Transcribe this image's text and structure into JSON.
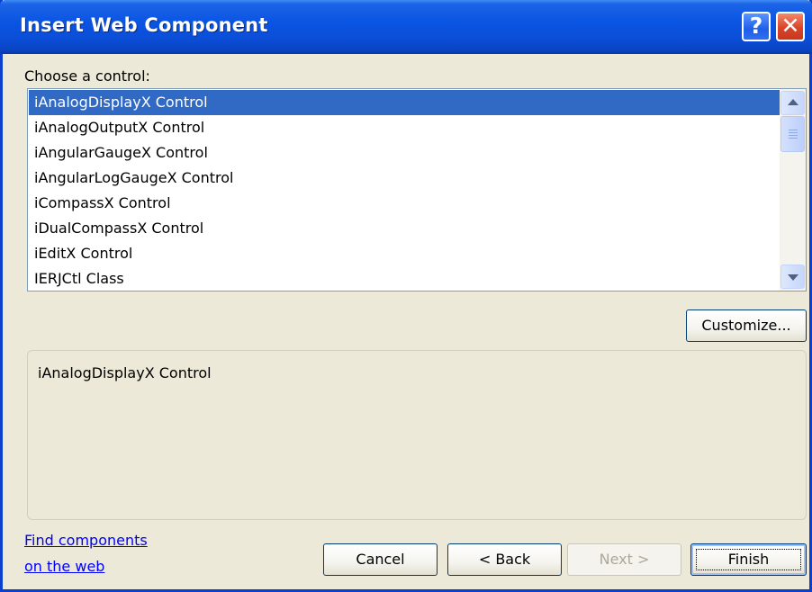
{
  "window": {
    "title": "Insert Web Component",
    "help_glyph": "?",
    "close_glyph": "✕"
  },
  "list": {
    "label": "Choose a control:",
    "items": [
      "iAnalogDisplayX Control",
      "iAnalogOutputX Control",
      "iAngularGaugeX Control",
      "iAngularLogGaugeX Control",
      "iCompassX Control",
      "iDualCompassX Control",
      "iEditX Control",
      "IERJCtl Class"
    ],
    "selected_index": 0
  },
  "customize_label": "Customize...",
  "description": "iAnalogDisplayX Control",
  "links": {
    "line1": "Find components",
    "line2": "on the web"
  },
  "buttons": {
    "cancel": "Cancel",
    "back": "< Back",
    "next": "Next >",
    "finish": "Finish"
  },
  "colors": {
    "title_bar": "#0a55e3",
    "selection": "#316ac5",
    "dialog_bg": "#ece9d8",
    "link": "#0000ff"
  }
}
